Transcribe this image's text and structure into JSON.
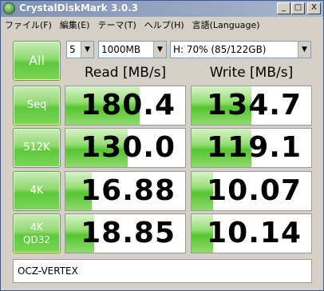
{
  "window": {
    "title": "CrystalDiskMark 3.0.3",
    "controls": {
      "minimize": "_",
      "maximize": "□",
      "close": "X"
    }
  },
  "menu": [
    "ファイル(F)",
    "編集(E)",
    "テーマ(T)",
    "ヘルプ(H)",
    "言語(Language)"
  ],
  "toolbar": {
    "all_label": "All",
    "count_value": "5",
    "size_value": "1000MB",
    "drive_value": "H: 70% (85/122GB)"
  },
  "columns": {
    "read": "Read [MB/s]",
    "write": "Write [MB/s]"
  },
  "rows": [
    {
      "label": "Seq",
      "label2": "",
      "read": "180.4",
      "write": "134.7",
      "read_fill": 0.62,
      "write_fill": 0.5
    },
    {
      "label": "512K",
      "label2": "",
      "read": "130.0",
      "write": "119.1",
      "read_fill": 0.52,
      "write_fill": 0.5
    },
    {
      "label": "4K",
      "label2": "",
      "read": "16.88",
      "write": "10.07",
      "read_fill": 0.22,
      "write_fill": 0.18
    },
    {
      "label": "4K",
      "label2": "QD32",
      "read": "18.85",
      "write": "10.14",
      "read_fill": 0.24,
      "write_fill": 0.18
    }
  ],
  "comment": "OCZ-VERTEX",
  "colors": {
    "accent_green": "#5cc93a",
    "titlebar": "#8fa2c0"
  }
}
